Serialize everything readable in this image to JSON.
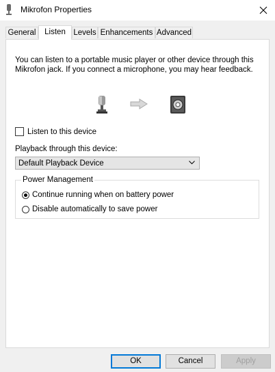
{
  "window": {
    "title": "Mikrofon Properties"
  },
  "tabs": [
    {
      "label": "General"
    },
    {
      "label": "Listen"
    },
    {
      "label": "Levels"
    },
    {
      "label": "Enhancements"
    },
    {
      "label": "Advanced"
    }
  ],
  "listen": {
    "description": "You can listen to a portable music player or other device through this Mikrofon jack.  If you connect a microphone, you may hear feedback.",
    "listen_checkbox_label": "Listen to this device",
    "playback_label": "Playback through this device:",
    "playback_selected": "Default Playback Device",
    "power_group_label": "Power Management",
    "radio_continue_label": "Continue running when on battery power",
    "radio_disable_label": "Disable automatically to save power"
  },
  "buttons": {
    "ok": "OK",
    "cancel": "Cancel",
    "apply": "Apply"
  },
  "icons": {
    "title": "microphone-icon",
    "close": "close-icon",
    "mic": "microphone-icon",
    "arrow": "arrow-right-icon",
    "speaker": "speaker-icon",
    "dropdown": "chevron-down-icon"
  },
  "colors": {
    "accent": "#0078d7",
    "panel": "#ffffff",
    "window": "#f0f0f0"
  }
}
